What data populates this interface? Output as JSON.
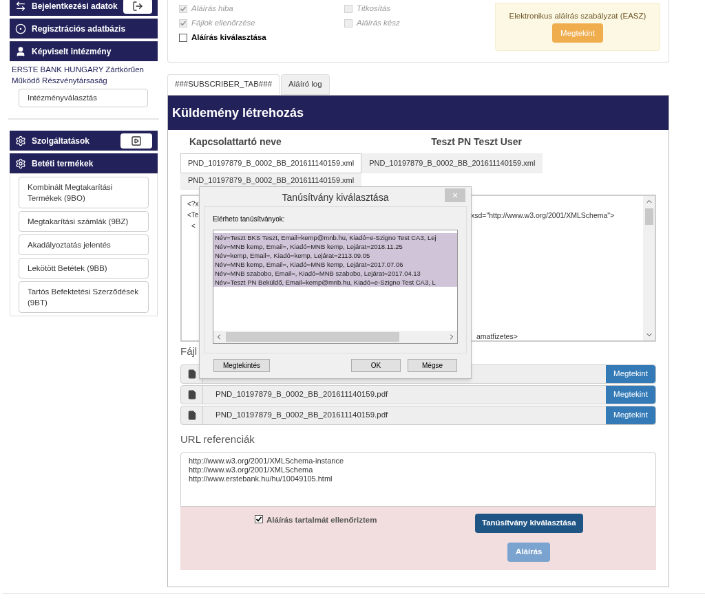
{
  "sidebar": {
    "headers": [
      {
        "label": "Bejelentkezési adatok"
      },
      {
        "label": "Regisztrációs adatbázis"
      },
      {
        "label": "Képviselt intézmény"
      }
    ],
    "institution": "ERSTE BANK HUNGARY Zártkörűen Működő Részvénytársaság",
    "institution_button": "Intézményválasztás",
    "groups": [
      {
        "label": "Szolgáltatások"
      },
      {
        "label": "Betéti termékek",
        "items": [
          "Kombinált Megtakarítási Termékek (9BO)",
          "Megtakarítási számlák (9BZ)",
          "Akadályoztatás jelentés",
          "Lekötött Betétek (9BB)",
          "Tartós Befektetési Szerződések (9BT)"
        ]
      }
    ]
  },
  "status_checks": [
    {
      "label": "Aláírás hiba",
      "checked": true,
      "disabled": true
    },
    {
      "label": "Fájlok ellenőrzése",
      "checked": true,
      "disabled": true
    },
    {
      "label": "Aláírás kiválasztása",
      "checked": false,
      "disabled": false
    },
    {
      "label": "Titkosítás",
      "checked": false,
      "disabled": true
    },
    {
      "label": "Aláírás kész",
      "checked": false,
      "disabled": true
    }
  ],
  "policy": {
    "text": "Elektronikus aláírás szabályzat (EASZ)",
    "button": "Megtekint"
  },
  "tabs": [
    {
      "label": "###SUBSCRIBER_TAB###",
      "selected": true
    },
    {
      "label": "Aláíró log",
      "selected": false
    }
  ],
  "panel": {
    "title": "Küldemény létrehozás",
    "contact_label": "Kapcsolattartó neve",
    "contact_value": "Teszt PN Teszt User",
    "file_tabs": [
      {
        "label": "PND_10197879_B_0002_BB_201611140159.xml",
        "selected": true
      },
      {
        "label": "PND_10197879_B_0002_BB_201611140159.xml",
        "selected": false
      },
      {
        "label": "PND_10197879_B_0002_BB_201611140159.xml",
        "selected": false
      }
    ],
    "xml_lines": [
      "<?x",
      "<Te",
      "<"
    ],
    "xml_visible_right": [
      "xsd=\"http://www.w3.org/2001/XMLSchema\">",
      "amatfizetes>"
    ],
    "files_label": "Fájl",
    "files": [
      {
        "button": "Megtekint"
      },
      {
        "name": "PND_10197879_B_0002_BB_201611140159.pdf",
        "button": "Megtekint"
      },
      {
        "name": "PND_10197879_B_0002_BB_201611140159.pdf",
        "button": "Megtekint"
      }
    ],
    "url_label": "URL referenciák",
    "urls": [
      "http://www.w3.org/2001/XMLSchema-instance",
      "http://www.w3.org/2001/XMLSchema",
      "http://www.erstebank.hu/hu/10049105.html"
    ],
    "confirm": {
      "label": "Aláírás tartalmát ellenőriztem",
      "checked": true
    },
    "select_cert_button": "Tanúsítvány kiválasztása",
    "sign_button": {
      "label": "Aláírás",
      "disabled": true
    }
  },
  "dialog": {
    "title": "Tanúsítvány kiválasztása",
    "close": "×",
    "list_label": "Elérheto tanúsítványok:",
    "certificates": [
      "Név=Teszt BKS Teszt, Email=kemp@mnb.hu, Kiadó=e-Szigno Test CA3, Lej",
      "Név=MNB kemp, Email=, Kiadó=MNB kemp, Lejárat=2018.11.25",
      "Név=kemp, Email=, Kiadó=kemp, Lejárat=2113.09.05",
      "Név=MNB kemp, Email=, Kiadó=MNB kemp, Lejárat=2017.07.06",
      "Név=MNB szabobo, Email=, Kiadó=MNB szabobo, Lejárat=2017.04.13",
      "Név=Teszt PN Beküldő, Email=kemp@mnb.hu, Kiadó=e-Szigno Test CA3, L"
    ],
    "buttons": [
      "Megtekintés",
      "OK",
      "Mégse"
    ]
  }
}
